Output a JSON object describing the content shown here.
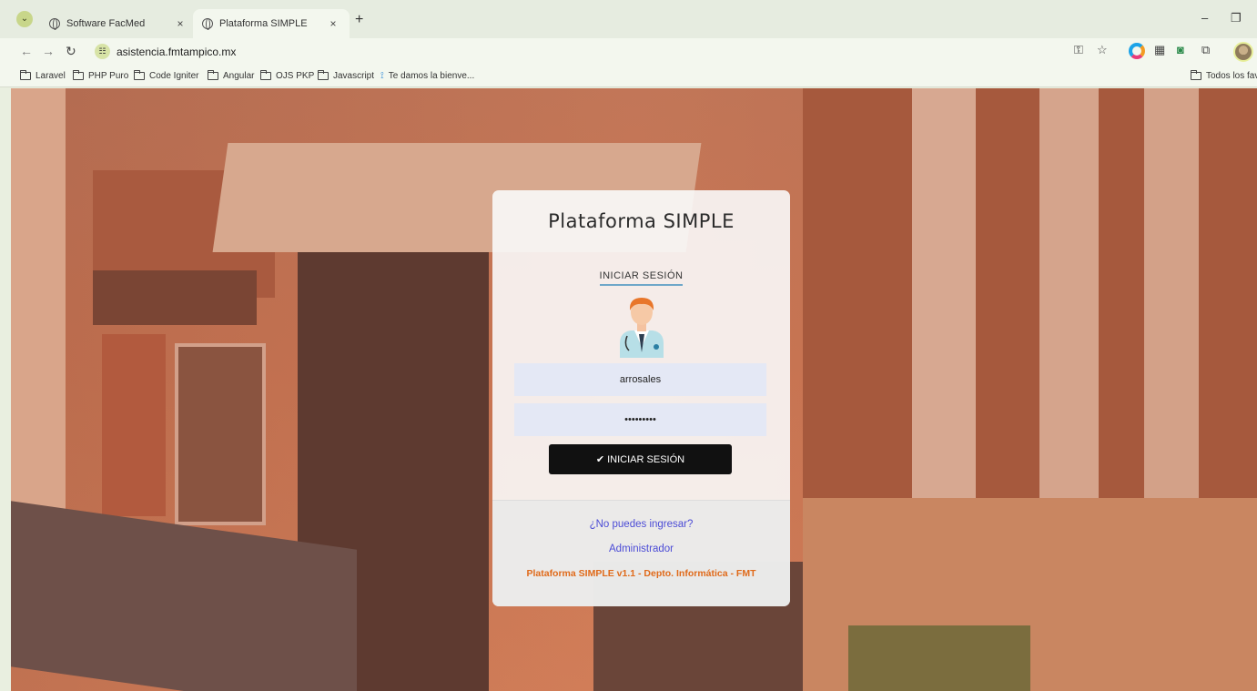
{
  "browser": {
    "tabs": [
      {
        "title": "Software FacMed",
        "active": false
      },
      {
        "title": "Plataforma SIMPLE",
        "active": true
      }
    ],
    "new_tab": "+",
    "close": "×",
    "url": "asistencia.fmtampico.mx",
    "bookmarks": [
      "Laravel",
      "PHP Puro",
      "Code Igniter",
      "Angular",
      "OJS PKP",
      "Javascript",
      "Te damos la bienve..."
    ],
    "all_bookmarks": "Todos los favo",
    "accent": "#c8d68a"
  },
  "login": {
    "title": "Plataforma SIMPLE",
    "heading": "INICIAR SESIÓN",
    "username_value": "arrosales",
    "password_value": "•••••••••",
    "submit_label": "INICIAR SESIÓN",
    "submit_icon": "✔",
    "cant_login": "¿No puedes ingresar?",
    "admin_link": "Administrador",
    "credit": "Plataforma SIMPLE v1.1 - Depto. Informática - FMT",
    "link_color": "#4c4cd6",
    "credit_color": "#e06a1a"
  }
}
